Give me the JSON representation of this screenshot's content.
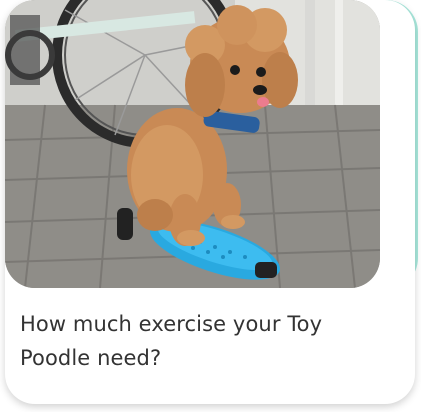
{
  "card": {
    "image_subject": "dog-photo",
    "title": "How much exercise your Toy Poodle need?"
  },
  "colors": {
    "accent": "#a9e9dd",
    "title_text": "#333333",
    "skateboard": "#29a9e0",
    "collar": "#2a5f9e",
    "fur": "#c98a55"
  }
}
